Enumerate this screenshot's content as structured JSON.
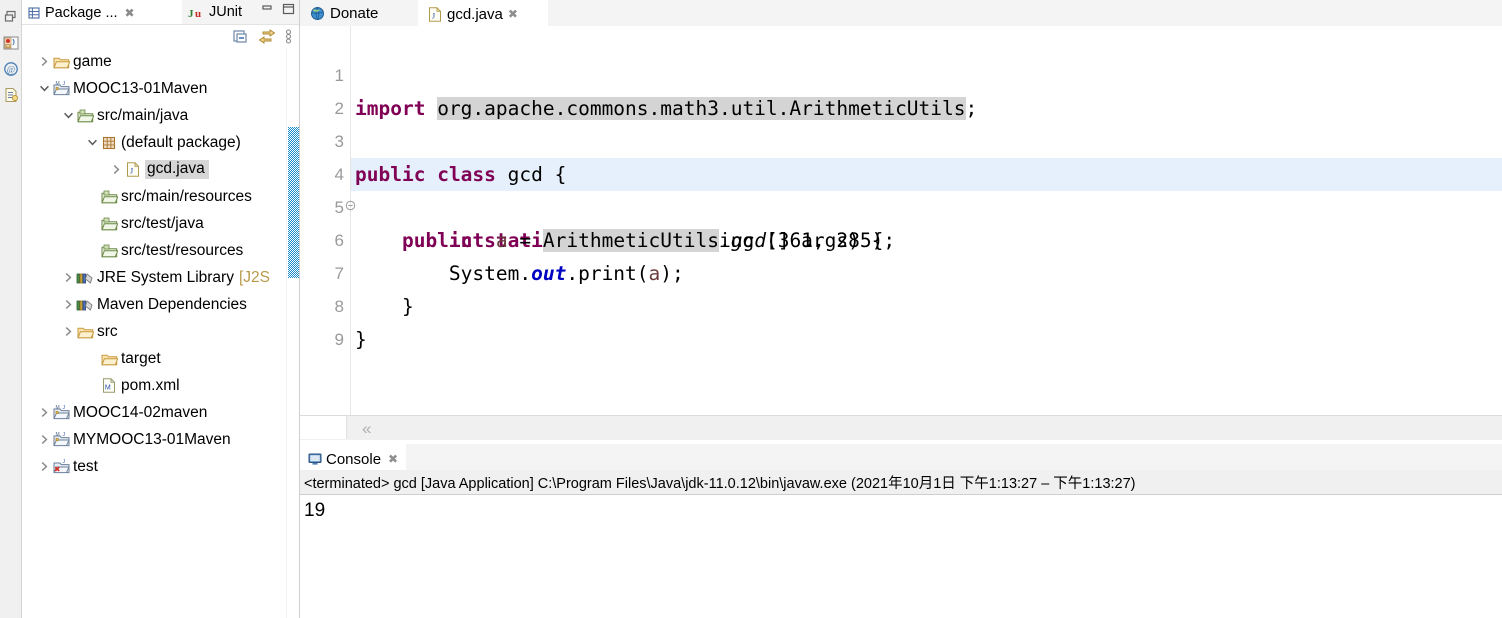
{
  "left_rail": {
    "icons": [
      {
        "name": "restore-perspective-icon",
        "title": "Restore"
      },
      {
        "name": "java-perspective-icon",
        "title": "Java"
      },
      {
        "name": "javadoc-at-icon",
        "title": "Javadoc"
      },
      {
        "name": "outline-view-icon",
        "title": "Outline"
      }
    ]
  },
  "explorer": {
    "tabs": [
      {
        "label": "Package ...",
        "icon": "package-explorer-icon",
        "active": true,
        "closable": true
      },
      {
        "label": "JUnit",
        "icon": "junit-icon",
        "active": false,
        "closable": false
      }
    ],
    "window_buttons": [
      {
        "name": "minimize-view-button",
        "glyph": "minimize"
      },
      {
        "name": "maximize-view-button",
        "glyph": "maximize"
      }
    ],
    "toolbar": [
      {
        "name": "collapse-all-button",
        "label": "Collapse All"
      },
      {
        "name": "link-with-editor-button",
        "label": "Link with Editor"
      },
      {
        "name": "view-menu-button",
        "label": "View Menu"
      }
    ],
    "tree": [
      {
        "label": "game",
        "indent": 0,
        "twisty": "collapsed",
        "icon": "folder-icon",
        "selected": false
      },
      {
        "label": "MOOC13-01Maven",
        "indent": 0,
        "twisty": "expanded",
        "icon": "maven-project-icon",
        "selected": false
      },
      {
        "label": "src/main/java",
        "indent": 1,
        "twisty": "expanded",
        "icon": "source-folder-icon",
        "selected": false
      },
      {
        "label": "(default package)",
        "indent": 2,
        "twisty": "expanded",
        "icon": "package-icon",
        "selected": false
      },
      {
        "label": "gcd.java",
        "indent": 3,
        "twisty": "collapsed",
        "icon": "java-file-icon",
        "selected": true
      },
      {
        "label": "src/main/resources",
        "indent": 2,
        "twisty": "none",
        "icon": "source-folder-icon",
        "selected": false
      },
      {
        "label": "src/test/java",
        "indent": 2,
        "twisty": "none",
        "icon": "source-folder-icon",
        "selected": false
      },
      {
        "label": "src/test/resources",
        "indent": 2,
        "twisty": "none",
        "icon": "source-folder-icon",
        "selected": false
      },
      {
        "label": "JRE System Library",
        "label_dim": "[J2S",
        "indent": 1,
        "twisty": "collapsed",
        "icon": "library-icon",
        "selected": false
      },
      {
        "label": "Maven Dependencies",
        "indent": 1,
        "twisty": "collapsed",
        "icon": "library-icon",
        "selected": false
      },
      {
        "label": "src",
        "indent": 1,
        "twisty": "collapsed",
        "icon": "folder-icon",
        "selected": false
      },
      {
        "label": "target",
        "indent": 2,
        "twisty": "none",
        "icon": "folder-icon",
        "selected": false
      },
      {
        "label": "pom.xml",
        "indent": 2,
        "twisty": "none",
        "icon": "xml-file-icon",
        "selected": false
      },
      {
        "label": "MOOC14-02maven",
        "indent": 0,
        "twisty": "collapsed",
        "icon": "maven-project-icon",
        "selected": false
      },
      {
        "label": "MYMOOC13-01Maven",
        "indent": 0,
        "twisty": "collapsed",
        "icon": "maven-project-icon",
        "selected": false
      },
      {
        "label": "test",
        "indent": 0,
        "twisty": "collapsed",
        "icon": "closed-project-icon",
        "selected": false
      }
    ]
  },
  "editor": {
    "tabs": [
      {
        "label": "Donate",
        "icon": "globe-icon",
        "active": false,
        "closable": false
      },
      {
        "label": "gcd.java",
        "icon": "java-file-icon",
        "active": true,
        "closable": true
      }
    ],
    "current_line": 5,
    "lines": [
      {
        "n": "1",
        "fold": false
      },
      {
        "n": "2",
        "fold": false
      },
      {
        "n": "3",
        "fold": false
      },
      {
        "n": "4",
        "fold": true
      },
      {
        "n": "5",
        "fold": false
      },
      {
        "n": "6",
        "fold": false
      },
      {
        "n": "7",
        "fold": false
      },
      {
        "n": "8",
        "fold": false
      },
      {
        "n": "9",
        "fold": false
      }
    ],
    "code": {
      "l1_kw": "import",
      "l1_pkg": "org.apache.commons.math3.util.ArithmeticUtils",
      "l1_semi": ";",
      "l3_a": "public",
      "l3_b": "class",
      "l3_c": " gcd {",
      "l4_a": "    public",
      "l4_b": "static",
      "l4_c": "void",
      "l4_d": " main(String [] args) {",
      "l5_a": "        ",
      "l5_kw": "int",
      "l5_b": " ",
      "l5_var": "a",
      "l5_c": " = ",
      "l5_cls": "ArithmeticUtils",
      "l5_dot": ".",
      "l5_mth": "gcd",
      "l5_args": "(361, 285);",
      "l6_a": "        System.",
      "l6_out": "out",
      "l6_b": ".print(",
      "l6_var": "a",
      "l6_c": ");",
      "l7": "    }",
      "l8": "}"
    },
    "breadcrumb_collapse": "«"
  },
  "console": {
    "tab_label": "Console",
    "tab_icon": "console-icon",
    "status": "<terminated> gcd [Java Application] C:\\Program Files\\Java\\jdk-11.0.12\\bin\\javaw.exe  (2021年10月1日 下午1:13:27 – 下午1:13:27)",
    "output": "19"
  },
  "colors": {
    "keyword": "#7f0055",
    "field": "#0000c0",
    "local": "#6a3e3e",
    "occurrence_highlight": "#d4d4d4",
    "current_line": "#e5f0fc",
    "selection": "#d6d6d6",
    "scrollbar": "#1a8ccc",
    "tab_inactive_bg": "#f4f4f4",
    "status_bg": "#f0f0f0"
  }
}
